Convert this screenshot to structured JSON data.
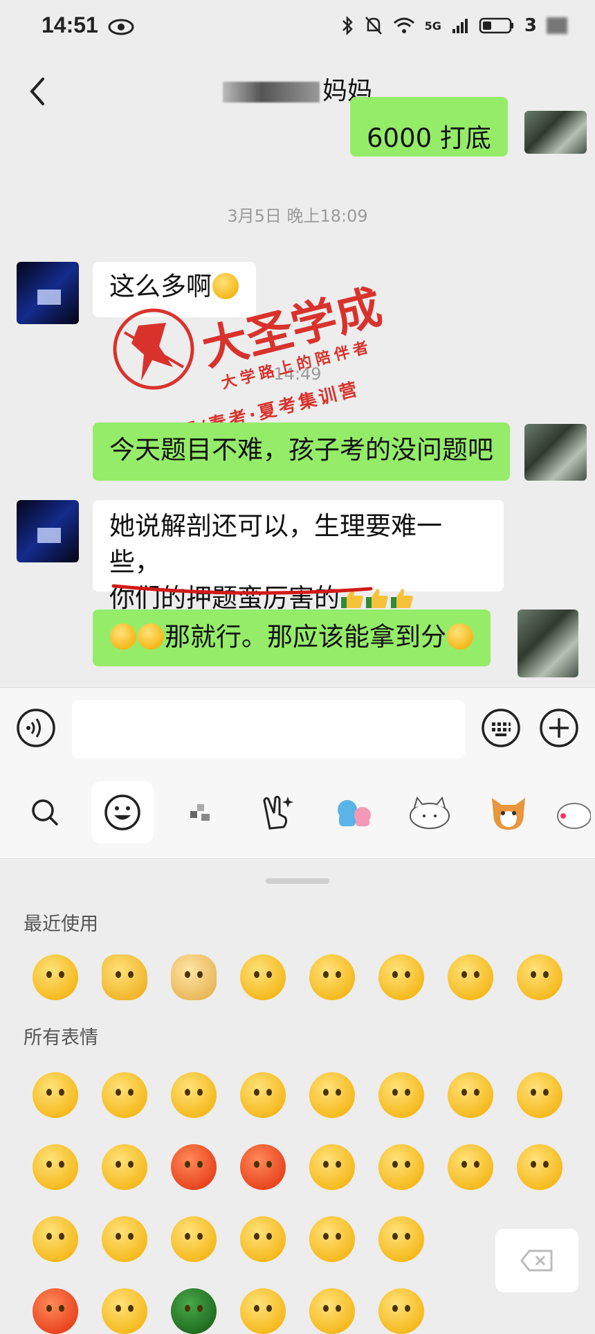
{
  "status": {
    "time": "14:51",
    "network": "5G",
    "battery": "3"
  },
  "header": {
    "title_suffix": "妈妈"
  },
  "chat": {
    "partial_top_message": "6000 打底",
    "timestamp_1": "3月5日 晚上18:09",
    "msg_1": "这么多啊",
    "timestamp_2": "14:49",
    "msg_2": "今天题目不难，孩子考的没问题吧",
    "msg_3_line1": "她说解剖还可以，生理要难一些，",
    "msg_3_line2": "你们的押题蛮厉害的",
    "msg_4": "那就行。那应该能拿到分"
  },
  "watermark": {
    "name": "大圣学成",
    "slogan": "大学路上的陪伴者",
    "subtitle": "单招/春考·夏考集训营"
  },
  "emoji_panel": {
    "recent_label": "最近使用",
    "all_label": "所有表情",
    "recent_count": 8,
    "all_rows": 4
  }
}
